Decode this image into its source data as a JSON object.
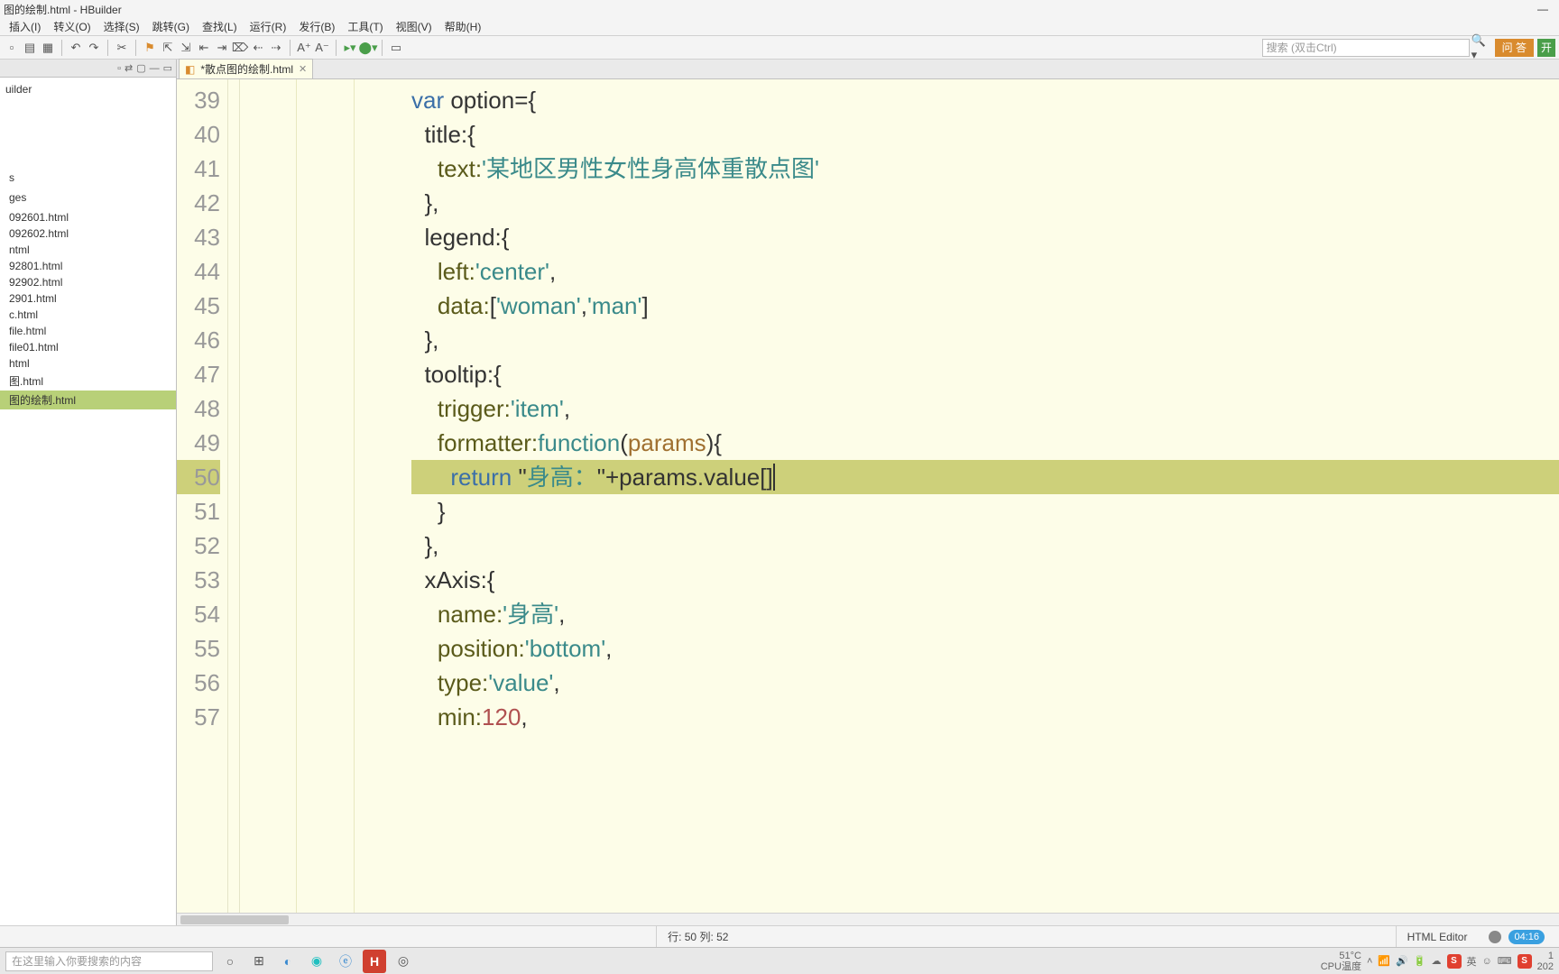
{
  "title": "图的绘制.html - HBuilder",
  "menu": [
    "插入(I)",
    "转义(O)",
    "选择(S)",
    "跳转(G)",
    "查找(L)",
    "运行(R)",
    "发行(B)",
    "工具(T)",
    "视图(V)",
    "帮助(H)"
  ],
  "search_placeholder": "搜索 (双击Ctrl)",
  "ask_btn": "问 答",
  "open_btn": "开",
  "sidebar_root": "uilder",
  "files": [
    "s",
    "",
    "ges",
    "",
    "092601.html",
    "092602.html",
    "ntml",
    "92801.html",
    "92902.html",
    "2901.html",
    "c.html",
    "file.html",
    "file01.html",
    "html",
    "图.html",
    "图的绘制.html"
  ],
  "selected_file_index": 15,
  "tab_name": "*散点图的绘制.html",
  "lines": [
    39,
    40,
    41,
    42,
    43,
    44,
    45,
    46,
    47,
    48,
    49,
    50,
    51,
    52,
    53,
    54,
    55,
    56,
    57
  ],
  "highlighted_line": 50,
  "code": {
    "l39": {
      "kw": "var",
      "rest": " option={"
    },
    "l40": "title:{",
    "l41": {
      "prop": "text:",
      "str": "'某地区男性女性身高体重散点图'"
    },
    "l42": "},",
    "l43": "legend:{",
    "l44": {
      "prop": "left:",
      "str": "'center'",
      "tail": ","
    },
    "l45": {
      "prop": "data:",
      "body": "[",
      "s1": "'woman'",
      "c": ",",
      "s2": "'man'",
      "end": "]"
    },
    "l46": "},",
    "l47": "tooltip:{",
    "l48": {
      "prop": "trigger:",
      "str": "'item'",
      "tail": ","
    },
    "l49": {
      "prop": "formatter:",
      "fn": "function",
      "paren": "(",
      "param": "params",
      "close": "){"
    },
    "l50": {
      "kw": "return ",
      "q": "\"",
      "str": "身高：",
      "q2": "\"",
      "plus": "+params.value[]"
    },
    "l51": "}",
    "l52": "},",
    "l53": "xAxis:{",
    "l54": {
      "prop": "name:",
      "str": "'身高'",
      "tail": ","
    },
    "l55": {
      "prop": "position:",
      "str": "'bottom'",
      "tail": ","
    },
    "l56": {
      "prop": "type:",
      "str": "'value'",
      "tail": ","
    },
    "l57": {
      "prop": "min:",
      "num": "120",
      "tail": ","
    }
  },
  "status": {
    "pos": "行: 50 列: 52",
    "mode": "HTML Editor",
    "clock": "04:16"
  },
  "taskbar": {
    "search": "在这里输入你要搜索的内容",
    "temp1": "51°C",
    "temp2": "CPU温度",
    "time1": "1",
    "time2": "202",
    "ime": "英"
  }
}
